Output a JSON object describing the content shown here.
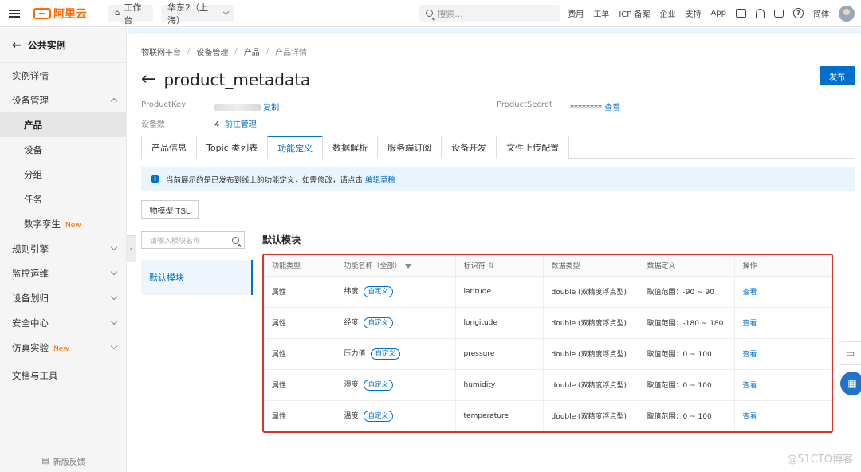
{
  "topbar": {
    "logo_text": "阿里云",
    "workbench": "工作台",
    "region": "华东2（上海）",
    "search_placeholder": "搜索...",
    "links": [
      "费用",
      "工单",
      "ICP 备案",
      "企业",
      "支持",
      "App"
    ],
    "lang": "简体"
  },
  "sidebar": {
    "back_label": "公共实例",
    "items": [
      {
        "label": "实例详情"
      },
      {
        "label": "设备管理"
      },
      {
        "label": "产品"
      },
      {
        "label": "设备"
      },
      {
        "label": "分组"
      },
      {
        "label": "任务"
      },
      {
        "label": "数字孪生",
        "badge": "New"
      },
      {
        "label": "规则引擎"
      },
      {
        "label": "监控运维"
      },
      {
        "label": "设备划归"
      },
      {
        "label": "安全中心"
      },
      {
        "label": "仿真实验",
        "badge": "New"
      },
      {
        "label": "文档与工具"
      }
    ],
    "footer": "新版反馈"
  },
  "breadcrumb": [
    "物联网平台",
    "设备管理",
    "产品",
    "产品详情"
  ],
  "page": {
    "title": "product_metadata",
    "publish_label": "发布",
    "product_key_label": "ProductKey",
    "copy_label": "复制",
    "device_count_label": "设备数",
    "device_count": "4",
    "manage_link": "前往管理",
    "product_secret_label": "ProductSecret",
    "product_secret_value": "********",
    "view_label": "查看"
  },
  "tabs": [
    "产品信息",
    "Topic 类列表",
    "功能定义",
    "数据解析",
    "服务端订阅",
    "设备开发",
    "文件上传配置"
  ],
  "info_bar": {
    "text": "当前展示的是已发布到线上的功能定义，如需修改，请点击",
    "link": "编辑草稿"
  },
  "tsl_button": "物模型 TSL",
  "module_panel": {
    "search_placeholder": "请输入模块名称",
    "selected_module": "默认模块",
    "title": "默认模块"
  },
  "table": {
    "headers": [
      "功能类型",
      "功能名称（全部）",
      "标识符",
      "数据类型",
      "数据定义",
      "操作"
    ],
    "rows": [
      {
        "type": "属性",
        "name": "纬度",
        "tag": "自定义",
        "identifier": "latitude",
        "data_type": "double (双精度浮点型)",
        "definition": "取值范围：-90 ~ 90",
        "action": "查看"
      },
      {
        "type": "属性",
        "name": "经度",
        "tag": "自定义",
        "identifier": "longitude",
        "data_type": "double (双精度浮点型)",
        "definition": "取值范围：-180 ~ 180",
        "action": "查看"
      },
      {
        "type": "属性",
        "name": "压力值",
        "tag": "自定义",
        "identifier": "pressure",
        "data_type": "double (双精度浮点型)",
        "definition": "取值范围：0 ~ 100",
        "action": "查看"
      },
      {
        "type": "属性",
        "name": "湿度",
        "tag": "自定义",
        "identifier": "humidity",
        "data_type": "double (双精度浮点型)",
        "definition": "取值范围：0 ~ 100",
        "action": "查看"
      },
      {
        "type": "属性",
        "name": "温度",
        "tag": "自定义",
        "identifier": "temperature",
        "data_type": "double (双精度浮点型)",
        "definition": "取值范围：0 ~ 100",
        "action": "查看"
      }
    ]
  },
  "watermark": "@51CTO博客",
  "colors": {
    "accent": "#0070cc",
    "brand": "#ff6a00",
    "highlight_border": "#d9342b"
  }
}
